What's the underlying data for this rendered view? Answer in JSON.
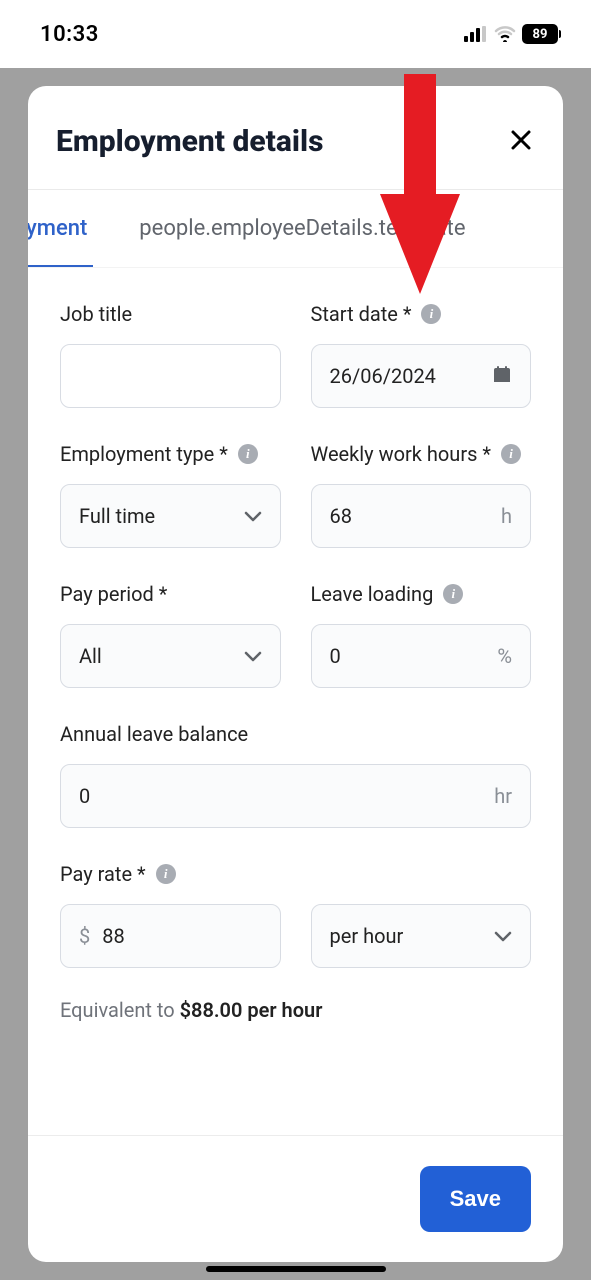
{
  "status": {
    "time": "10:33",
    "battery": "89"
  },
  "modal": {
    "title": "Employment details",
    "tabs": [
      {
        "label": "yment",
        "active": true
      },
      {
        "label": "people.employeeDetails.template",
        "active": false
      }
    ]
  },
  "fields": {
    "jobTitle": {
      "label": "Job title",
      "value": ""
    },
    "startDate": {
      "label": "Start date *",
      "value": "26/06/2024"
    },
    "employmentType": {
      "label": "Employment type *",
      "value": "Full time"
    },
    "weeklyHours": {
      "label": "Weekly work hours *",
      "value": "68",
      "unit": "h"
    },
    "payPeriod": {
      "label": "Pay period *",
      "value": "All"
    },
    "leaveLoading": {
      "label": "Leave loading",
      "value": "0",
      "unit": "%"
    },
    "annualLeave": {
      "label": "Annual leave balance",
      "value": "0",
      "unit": "hr"
    },
    "payRate": {
      "label": "Pay rate *",
      "prefix": "$",
      "value": "88",
      "unitValue": "per hour"
    },
    "equivalent": {
      "prefix": "Equivalent to ",
      "amount": "$88.00 per hour"
    }
  },
  "footer": {
    "save": "Save"
  }
}
